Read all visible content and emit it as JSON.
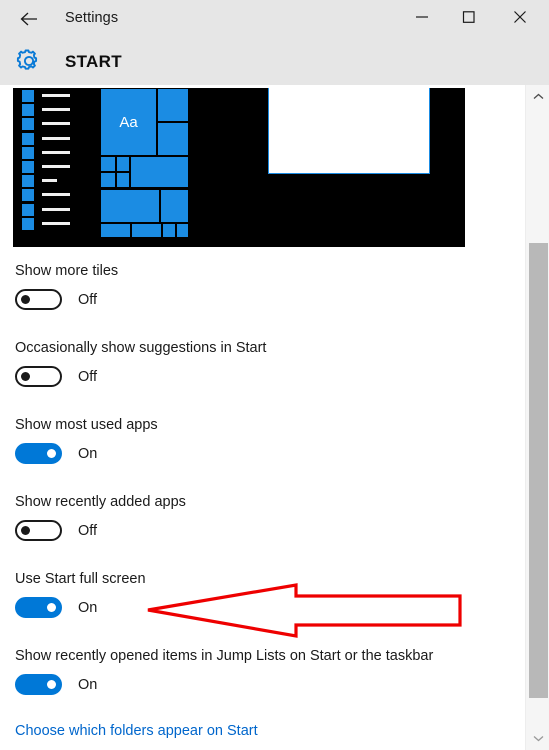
{
  "window": {
    "title": "Settings",
    "back_icon": "back-arrow-icon",
    "minimize_label": "─",
    "maximize_label": "□",
    "close_label": "✕"
  },
  "header": {
    "icon": "gear-icon",
    "title": "START",
    "accent_color": "#0078d7"
  },
  "preview": {
    "name": "start-menu-preview-image",
    "background_color": "#000000",
    "tile_color": "#1b8ce3",
    "tile_label": "Aa",
    "app_rows": 10,
    "short_line_row": 7
  },
  "settings": [
    {
      "label": "Show more tiles",
      "state": "Off",
      "on": false
    },
    {
      "label": "Occasionally show suggestions in Start",
      "state": "Off",
      "on": false
    },
    {
      "label": "Show most used apps",
      "state": "On",
      "on": true
    },
    {
      "label": "Show recently added apps",
      "state": "Off",
      "on": false
    },
    {
      "label": "Use Start full screen",
      "state": "On",
      "on": true
    },
    {
      "label": "Show recently opened items in Jump Lists on Start or the taskbar",
      "state": "On",
      "on": true
    }
  ],
  "link": {
    "label": "Choose which folders appear on Start",
    "color": "#0066cc"
  },
  "annotation": {
    "name": "red-arrow-pointer",
    "color": "#ee0000",
    "points_to": "Use Start full screen"
  },
  "scrollbar": {
    "up_icon": "chevron-up-icon",
    "down_icon": "chevron-down-icon",
    "thumb_color": "#b8b8b8"
  }
}
